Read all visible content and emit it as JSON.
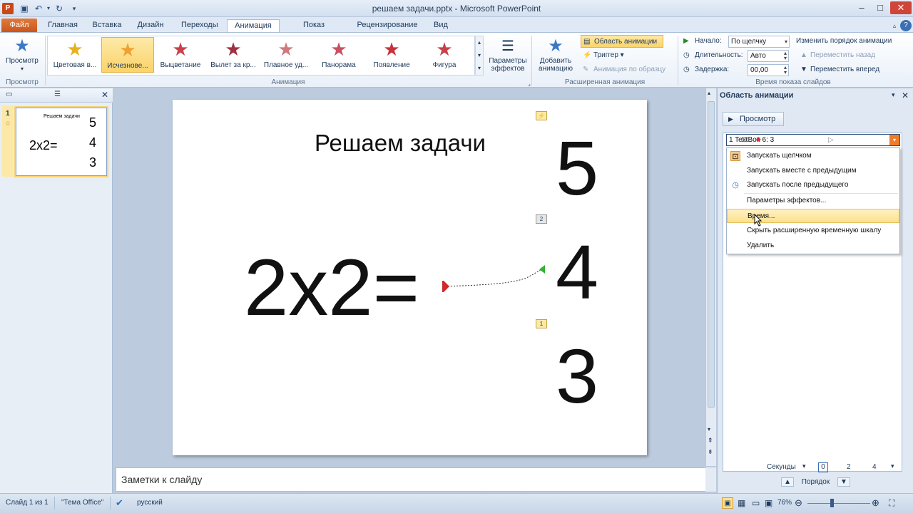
{
  "window": {
    "title": "решаем задачи.pptx - Microsoft PowerPoint",
    "qa_icons": [
      "save-icon",
      "undo-icon",
      "redo-icon"
    ]
  },
  "tabs": [
    "Файл",
    "Главная",
    "Вставка",
    "Дизайн",
    "Переходы",
    "Анимация",
    "Показ слайдов",
    "Рецензирование",
    "Вид"
  ],
  "ribbon": {
    "preview": {
      "label": "Просмотр",
      "group": "Просмотр"
    },
    "gallery": [
      {
        "label": "Цветовая в...",
        "color": "#e8b21c"
      },
      {
        "label": "Исчезнове...",
        "color": "#f0a030",
        "selected": true
      },
      {
        "label": "Выцветание",
        "color": "#c8404a"
      },
      {
        "label": "Вылет за кр...",
        "color": "#a03040"
      },
      {
        "label": "Плавное уд...",
        "color": "#d07a80"
      },
      {
        "label": "Панорама",
        "color": "#c85060"
      },
      {
        "label": "Появление",
        "color": "#c8303a"
      },
      {
        "label": "Фигура",
        "color": "#c84048"
      }
    ],
    "effect_params": "Параметры эффектов",
    "animation_group": "Анимация",
    "add_animation": "Добавить анимацию",
    "animation_pane": "Область анимации",
    "trigger": "Триггер",
    "painter": "Анимация по образцу",
    "advanced_group": "Расширенная анимация",
    "start_label": "Начало:",
    "start_value": "По щелчку",
    "duration_label": "Длительность:",
    "duration_value": "Авто",
    "delay_label": "Задержка:",
    "delay_value": "00,00",
    "reorder_title": "Изменить порядок анимации",
    "move_back": "Переместить назад",
    "move_forward": "Переместить вперед",
    "timing_group": "Время показа слайдов"
  },
  "thumbnail": {
    "number": "1",
    "title": "Решаем задачи",
    "expr": "2x2=",
    "n5": "5",
    "n4": "4",
    "n3": "3"
  },
  "slide": {
    "title": "Решаем задачи",
    "expression": "2x2=",
    "answer5": "5",
    "answer4": "4",
    "answer3": "3",
    "tag2": "2",
    "tag1": "1"
  },
  "notes": {
    "placeholder": "Заметки к слайду"
  },
  "anim_pane": {
    "title": "Область анимации",
    "play": "Просмотр",
    "item": "1   TextBox 6: 3",
    "menu": [
      "Запускать щелчком",
      "Запускать вместе с предыдущим",
      "Запускать после предыдущего",
      "Параметры эффектов...",
      "Время...",
      "Скрыть расширенную временную шкалу",
      "Удалить"
    ],
    "seconds": "Секунды",
    "ticks": [
      "0",
      "2",
      "4"
    ],
    "order": "Порядок"
  },
  "status": {
    "slide": "Слайд 1 из 1",
    "theme": "\"Тема Office\"",
    "lang": "русский",
    "zoom": "76%"
  }
}
